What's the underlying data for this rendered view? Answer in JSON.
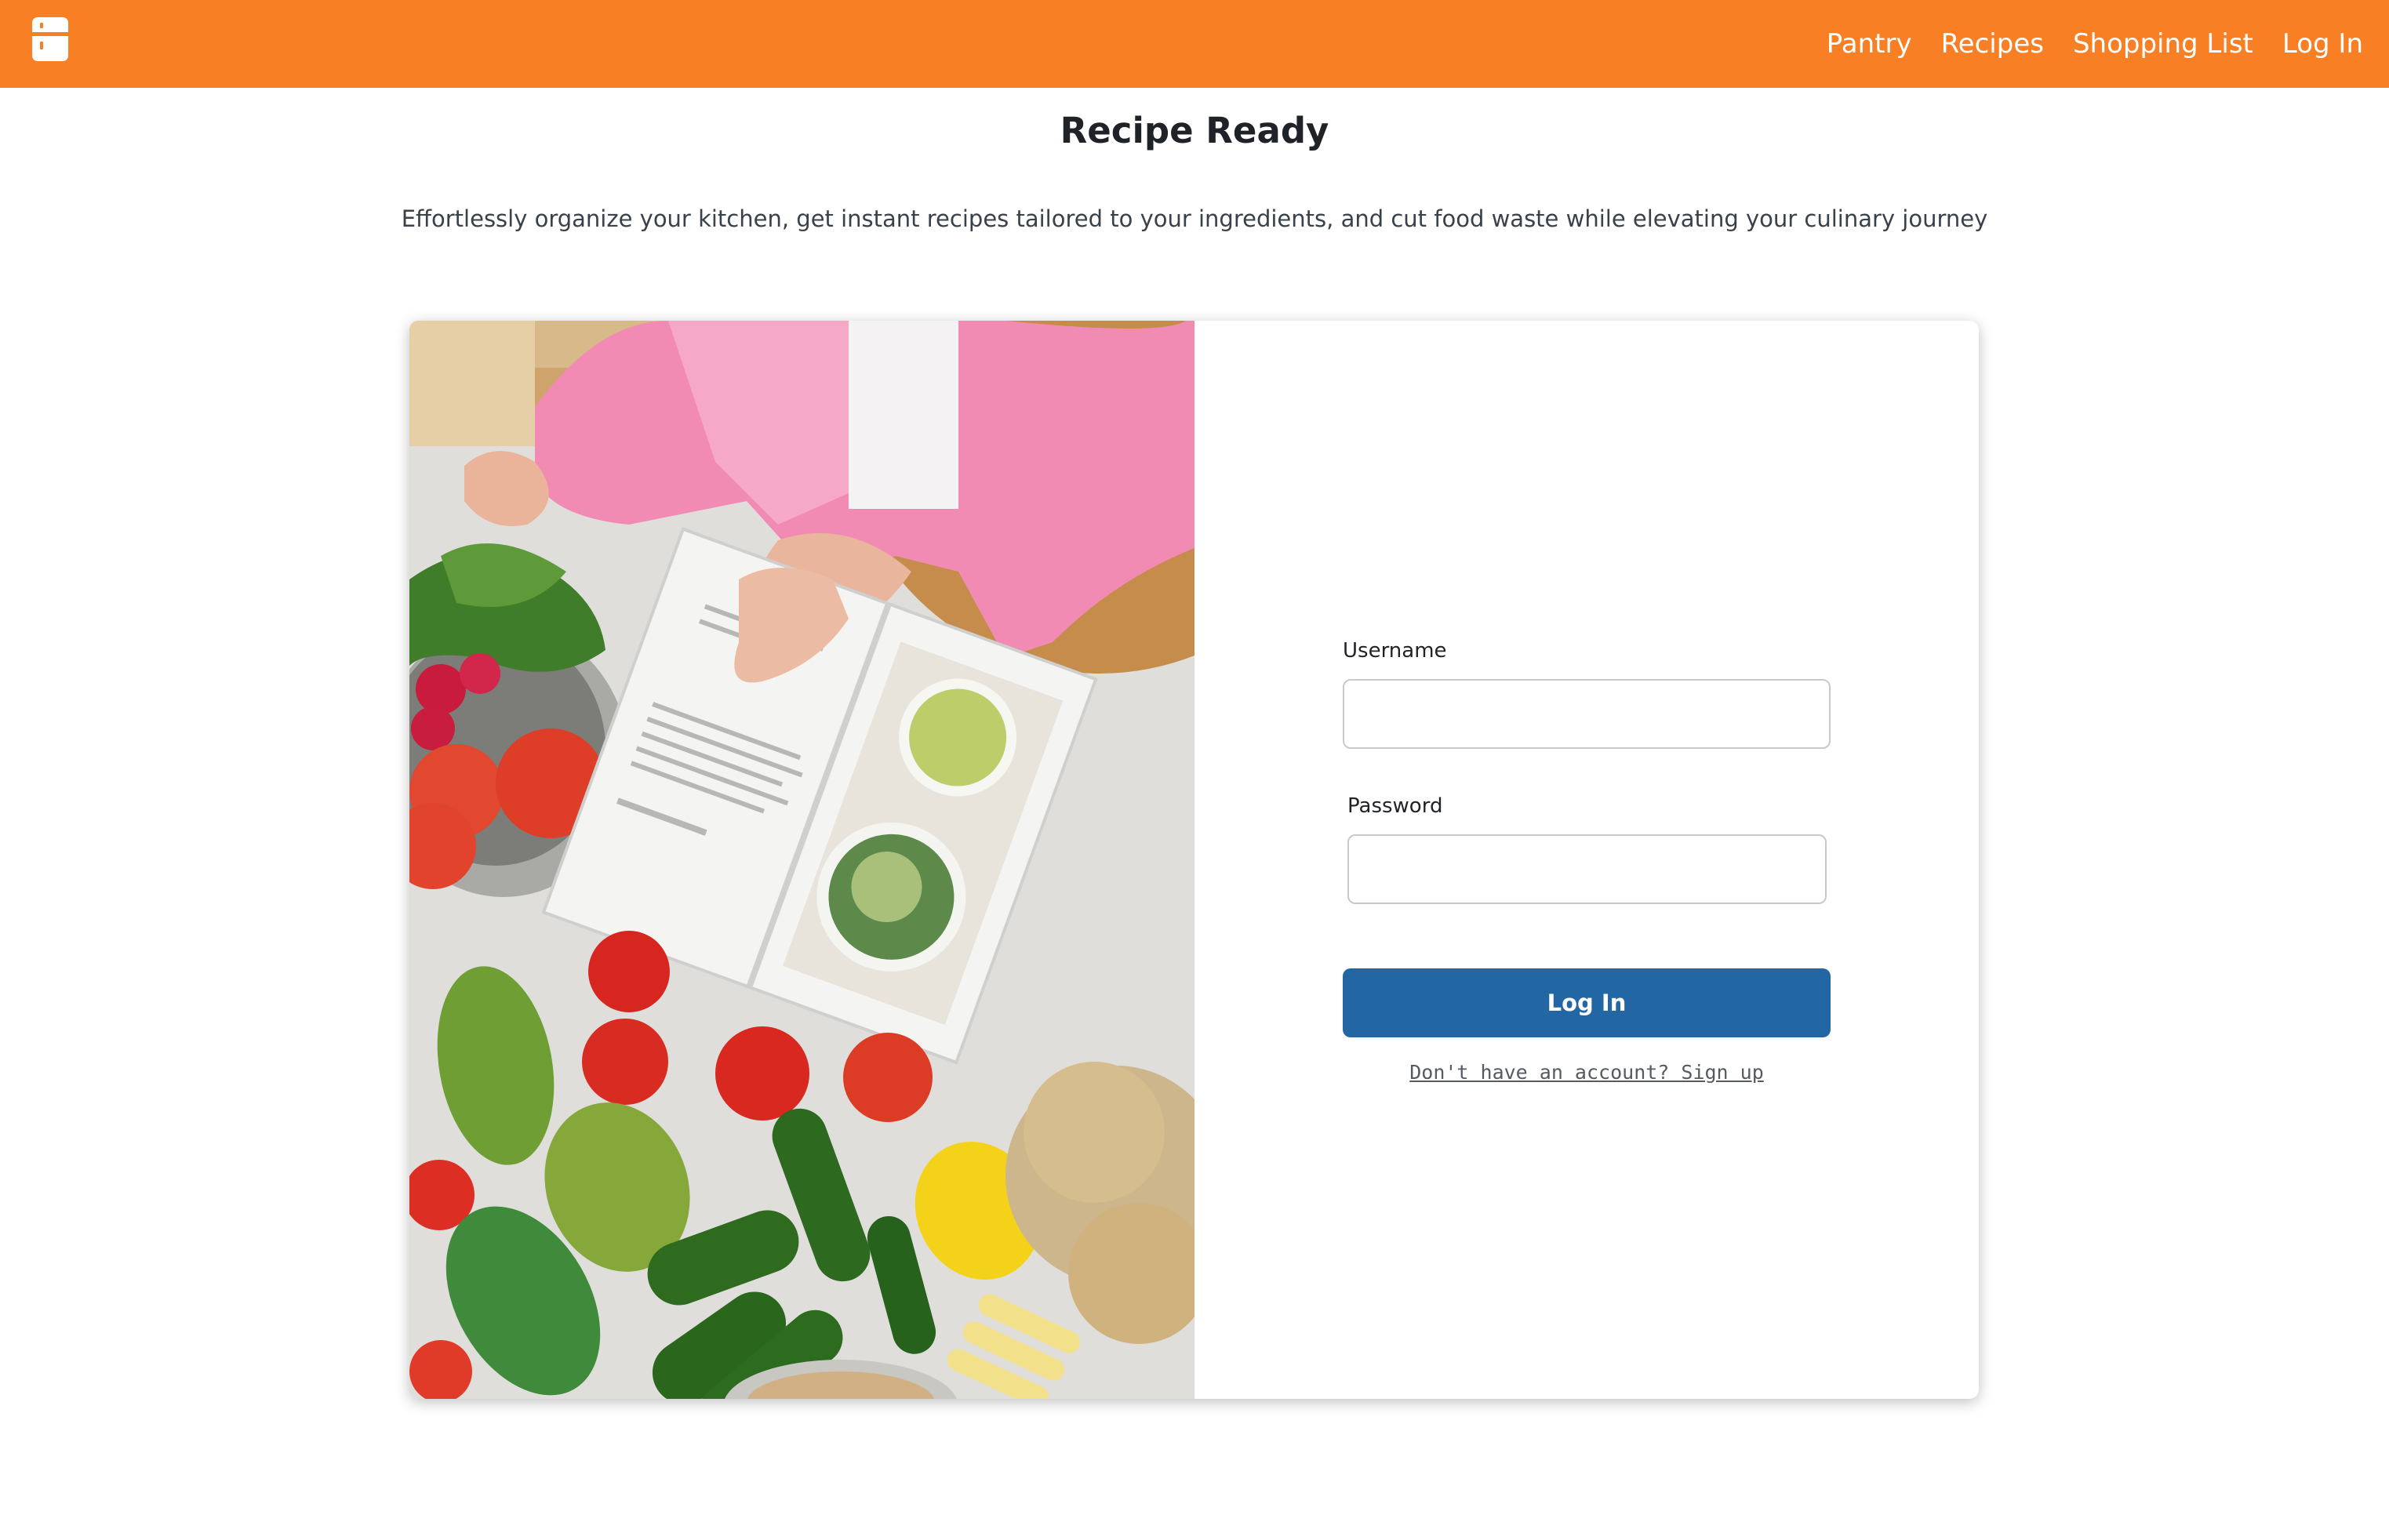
{
  "header": {
    "logo_icon": "refrigerator-icon",
    "background_color": "#F97F24",
    "nav": [
      {
        "label": "Pantry"
      },
      {
        "label": "Recipes"
      },
      {
        "label": "Shopping List"
      },
      {
        "label": "Log In"
      }
    ]
  },
  "hero": {
    "title": "Recipe Ready",
    "subtitle": "Effortlessly organize your kitchen, get instant recipes tailored to your ingredients, and cut food waste while elevating your culinary journey"
  },
  "login_form": {
    "username_label": "Username",
    "username_value": "",
    "password_label": "Password",
    "password_value": "",
    "submit_label": "Log In",
    "submit_color": "#2267A4",
    "signup_text": "Don't have an account? Sign up"
  }
}
